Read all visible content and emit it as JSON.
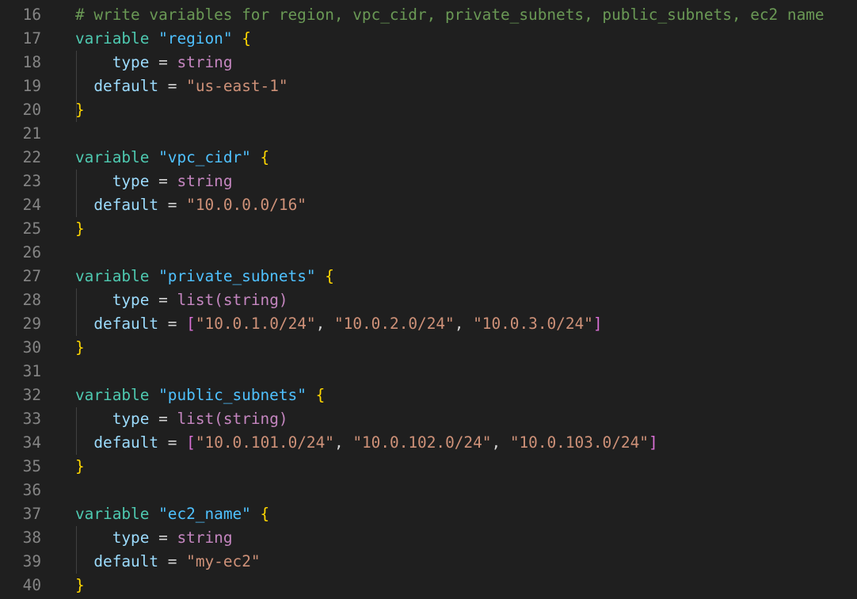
{
  "editor": {
    "language": "terraform",
    "colors": {
      "background": "#1f1f1f",
      "line_number": "#858585",
      "comment": "#6a9955",
      "keyword": "#4ec9b0",
      "block_name": "#4fc1ff",
      "brace": "#ffd700",
      "attribute": "#9cdcfe",
      "type": "#c586c0",
      "string": "#ce9178",
      "bracket": "#da70d6"
    },
    "lines": [
      {
        "n": "16",
        "comment": "# write variables for region, vpc_cidr, private_subnets, public_subnets, ec2 name"
      },
      {
        "n": "17",
        "kw": "variable",
        "name": "\"region\"",
        "brace": "{"
      },
      {
        "n": "18",
        "attr": "type",
        "op": "=",
        "type": "string"
      },
      {
        "n": "19",
        "attr": "default",
        "op": "=",
        "str": "\"us-east-1\""
      },
      {
        "n": "20",
        "brace": "}"
      },
      {
        "n": "21"
      },
      {
        "n": "22",
        "kw": "variable",
        "name": "\"vpc_cidr\"",
        "brace": "{"
      },
      {
        "n": "23",
        "attr": "type",
        "op": "=",
        "type": "string"
      },
      {
        "n": "24",
        "attr": "default",
        "op": "=",
        "str": "\"10.0.0.0/16\""
      },
      {
        "n": "25",
        "brace": "}"
      },
      {
        "n": "26"
      },
      {
        "n": "27",
        "kw": "variable",
        "name": "\"private_subnets\"",
        "brace": "{"
      },
      {
        "n": "28",
        "attr": "type",
        "op": "=",
        "type": "list(string)"
      },
      {
        "n": "29",
        "attr": "default",
        "op": "=",
        "list": [
          "\"10.0.1.0/24\"",
          "\"10.0.2.0/24\"",
          "\"10.0.3.0/24\""
        ]
      },
      {
        "n": "30",
        "brace": "}"
      },
      {
        "n": "31"
      },
      {
        "n": "32",
        "kw": "variable",
        "name": "\"public_subnets\"",
        "brace": "{"
      },
      {
        "n": "33",
        "attr": "type",
        "op": "=",
        "type": "list(string)"
      },
      {
        "n": "34",
        "attr": "default",
        "op": "=",
        "list": [
          "\"10.0.101.0/24\"",
          "\"10.0.102.0/24\"",
          "\"10.0.103.0/24\""
        ]
      },
      {
        "n": "35",
        "brace": "}"
      },
      {
        "n": "36"
      },
      {
        "n": "37",
        "kw": "variable",
        "name": "\"ec2_name\"",
        "brace": "{"
      },
      {
        "n": "38",
        "attr": "type",
        "op": "=",
        "type": "string"
      },
      {
        "n": "39",
        "attr": "default",
        "op": "=",
        "str": "\"my-ec2\""
      },
      {
        "n": "40",
        "brace": "}"
      }
    ]
  }
}
